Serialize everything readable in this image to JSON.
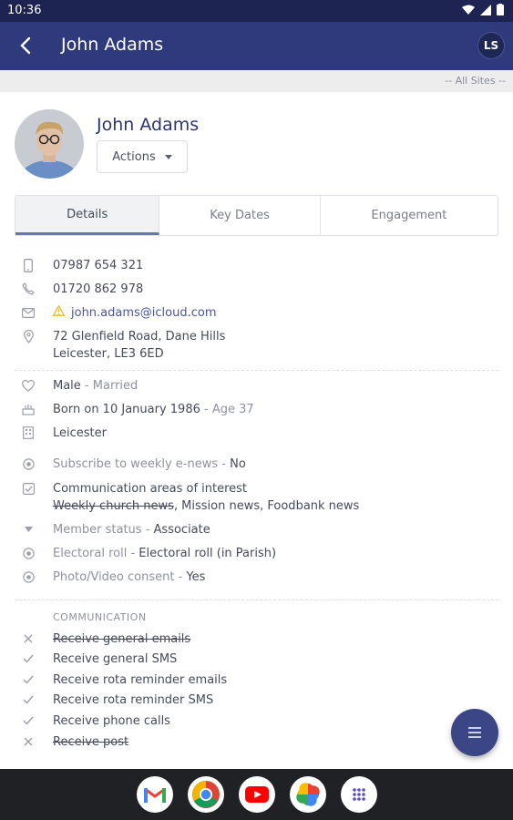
{
  "status_bar": {
    "time": "10:36"
  },
  "app_bar": {
    "title": "John Adams",
    "avatar_initials": "LS"
  },
  "sites_filter": "-- All Sites --",
  "profile": {
    "name": "John Adams",
    "actions_label": "Actions"
  },
  "tabs": [
    {
      "label": "Details",
      "active": true
    },
    {
      "label": "Key Dates",
      "active": false
    },
    {
      "label": "Engagement",
      "active": false
    }
  ],
  "contact": {
    "mobile": "07987 654 321",
    "phone": "01720 862 978",
    "email": "john.adams@icloud.com",
    "address_line1": "72 Glenfield Road, Dane Hills",
    "address_line2": "Leicester, LE3 6ED"
  },
  "personal": {
    "gender": "Male",
    "marital_sep": " - ",
    "marital": "Married",
    "born": "Born on 10 January 1986",
    "age_sep": " - ",
    "age": "Age 37",
    "site": "Leicester"
  },
  "fields": {
    "enews_label": "Subscribe to weekly e-news",
    "sep": " - ",
    "enews_value": "No",
    "interests_label": "Communication areas of interest",
    "interest_struck": "Weekly church news",
    "interest_rest": ", Mission news, Foodbank news",
    "member_label": "Member status",
    "member_value": "Associate",
    "electoral_label": "Electoral roll",
    "electoral_value": "Electoral roll (in Parish)",
    "photo_label": "Photo/Video consent",
    "photo_value": "Yes"
  },
  "communication": {
    "header": "COMMUNICATION",
    "items": [
      {
        "label": "Receive general emails",
        "enabled": false
      },
      {
        "label": "Receive general SMS",
        "enabled": true
      },
      {
        "label": "Receive rota reminder emails",
        "enabled": true
      },
      {
        "label": "Receive rota reminder SMS",
        "enabled": true
      },
      {
        "label": "Receive phone calls",
        "enabled": true
      },
      {
        "label": "Receive post",
        "enabled": false
      }
    ]
  },
  "colors": {
    "app_bar": "#2f3a7c",
    "status_bar": "#1e2451",
    "enabled_green": "#4aa56a",
    "warning": "#f0b429"
  },
  "nav_apps": [
    "gmail-icon",
    "chrome-icon",
    "youtube-icon",
    "photos-icon",
    "app-drawer-icon"
  ]
}
